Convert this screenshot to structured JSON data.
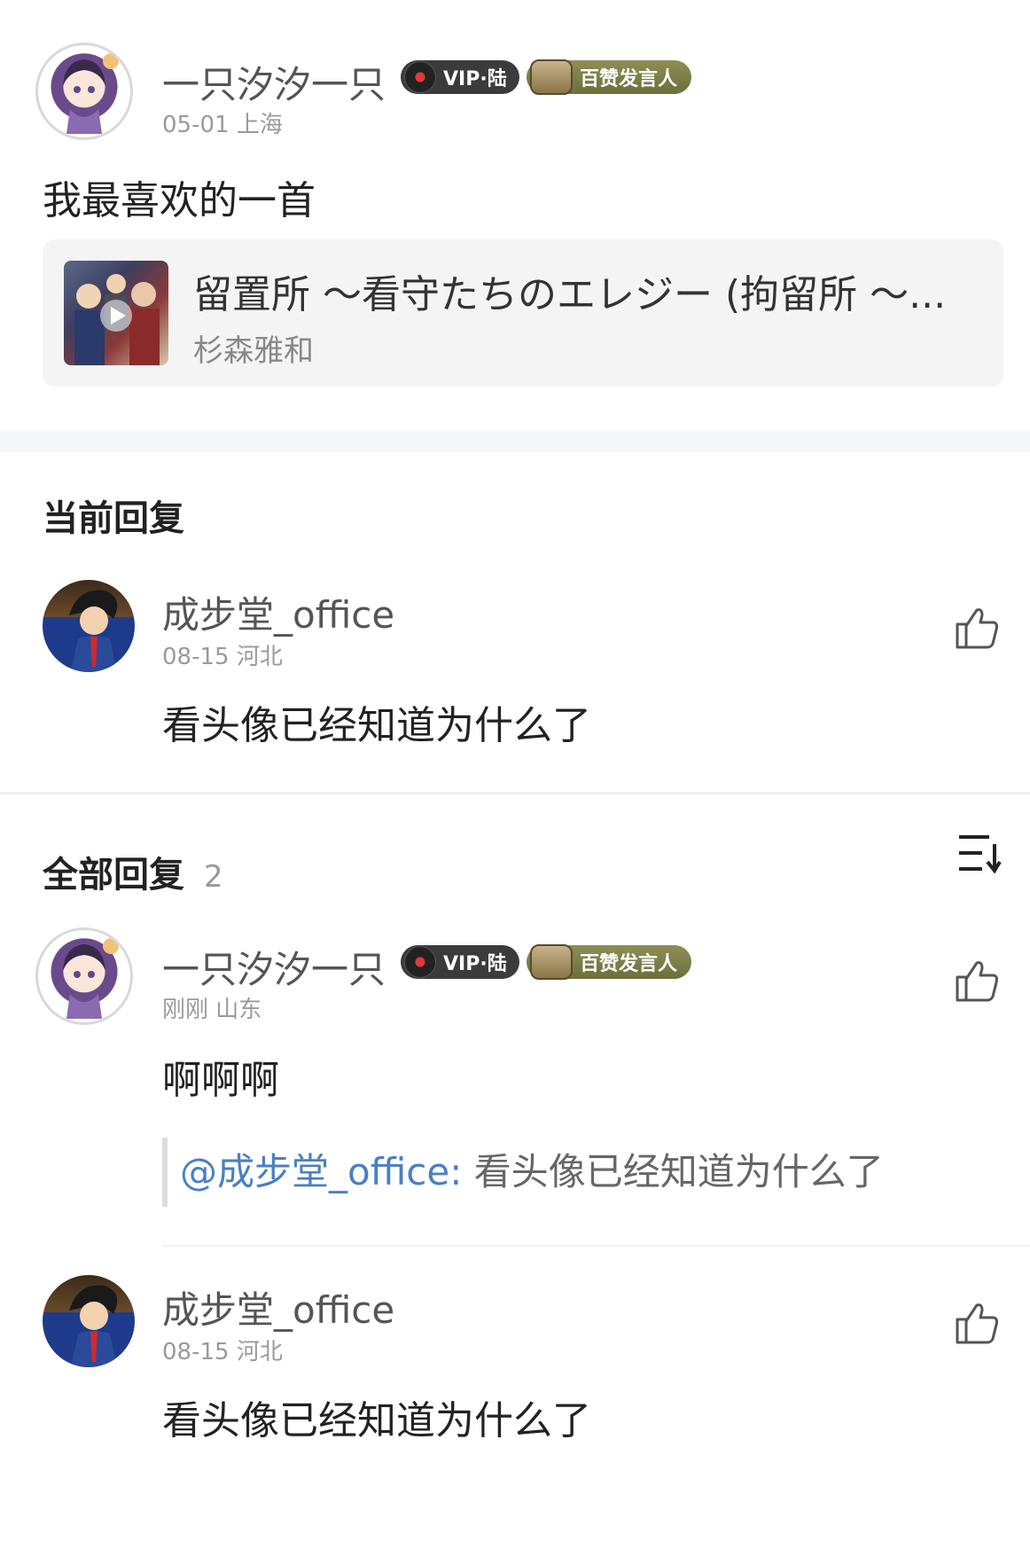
{
  "original_post": {
    "user_name": "一只汐汐一只",
    "vip_badge": "VIP·陆",
    "title_badge": "百赞发言人",
    "date": "05-01",
    "location": "上海",
    "text": "我最喜欢的一首",
    "song": {
      "title": "留置所 ～看守たちのエレジー (拘留所 ～...",
      "artist": "杉森雅和"
    }
  },
  "current_reply": {
    "section_title": "当前回复",
    "user_name": "成步堂_office",
    "date": "08-15",
    "location": "河北",
    "text": "看头像已经知道为什么了"
  },
  "all_replies": {
    "section_title": "全部回复",
    "count": "2",
    "items": [
      {
        "user_name": "一只汐汐一只",
        "vip_badge": "VIP·陆",
        "title_badge": "百赞发言人",
        "date": "刚刚",
        "location": "山东",
        "text": "啊啊啊",
        "quote_mention": "@成步堂_office:",
        "quote_text": " 看头像已经知道为什么了"
      },
      {
        "user_name": "成步堂_office",
        "date": "08-15",
        "location": "河北",
        "text": "看头像已经知道为什么了"
      }
    ]
  },
  "icons": {
    "like": "thumbs-up-icon",
    "sort": "sort-icon",
    "vinyl": "vinyl-record-icon",
    "typewriter": "typewriter-icon"
  },
  "colors": {
    "mention": "#4a7fc1",
    "section_divider": "#f5f6f8",
    "card_bg": "#f4f4f4"
  }
}
